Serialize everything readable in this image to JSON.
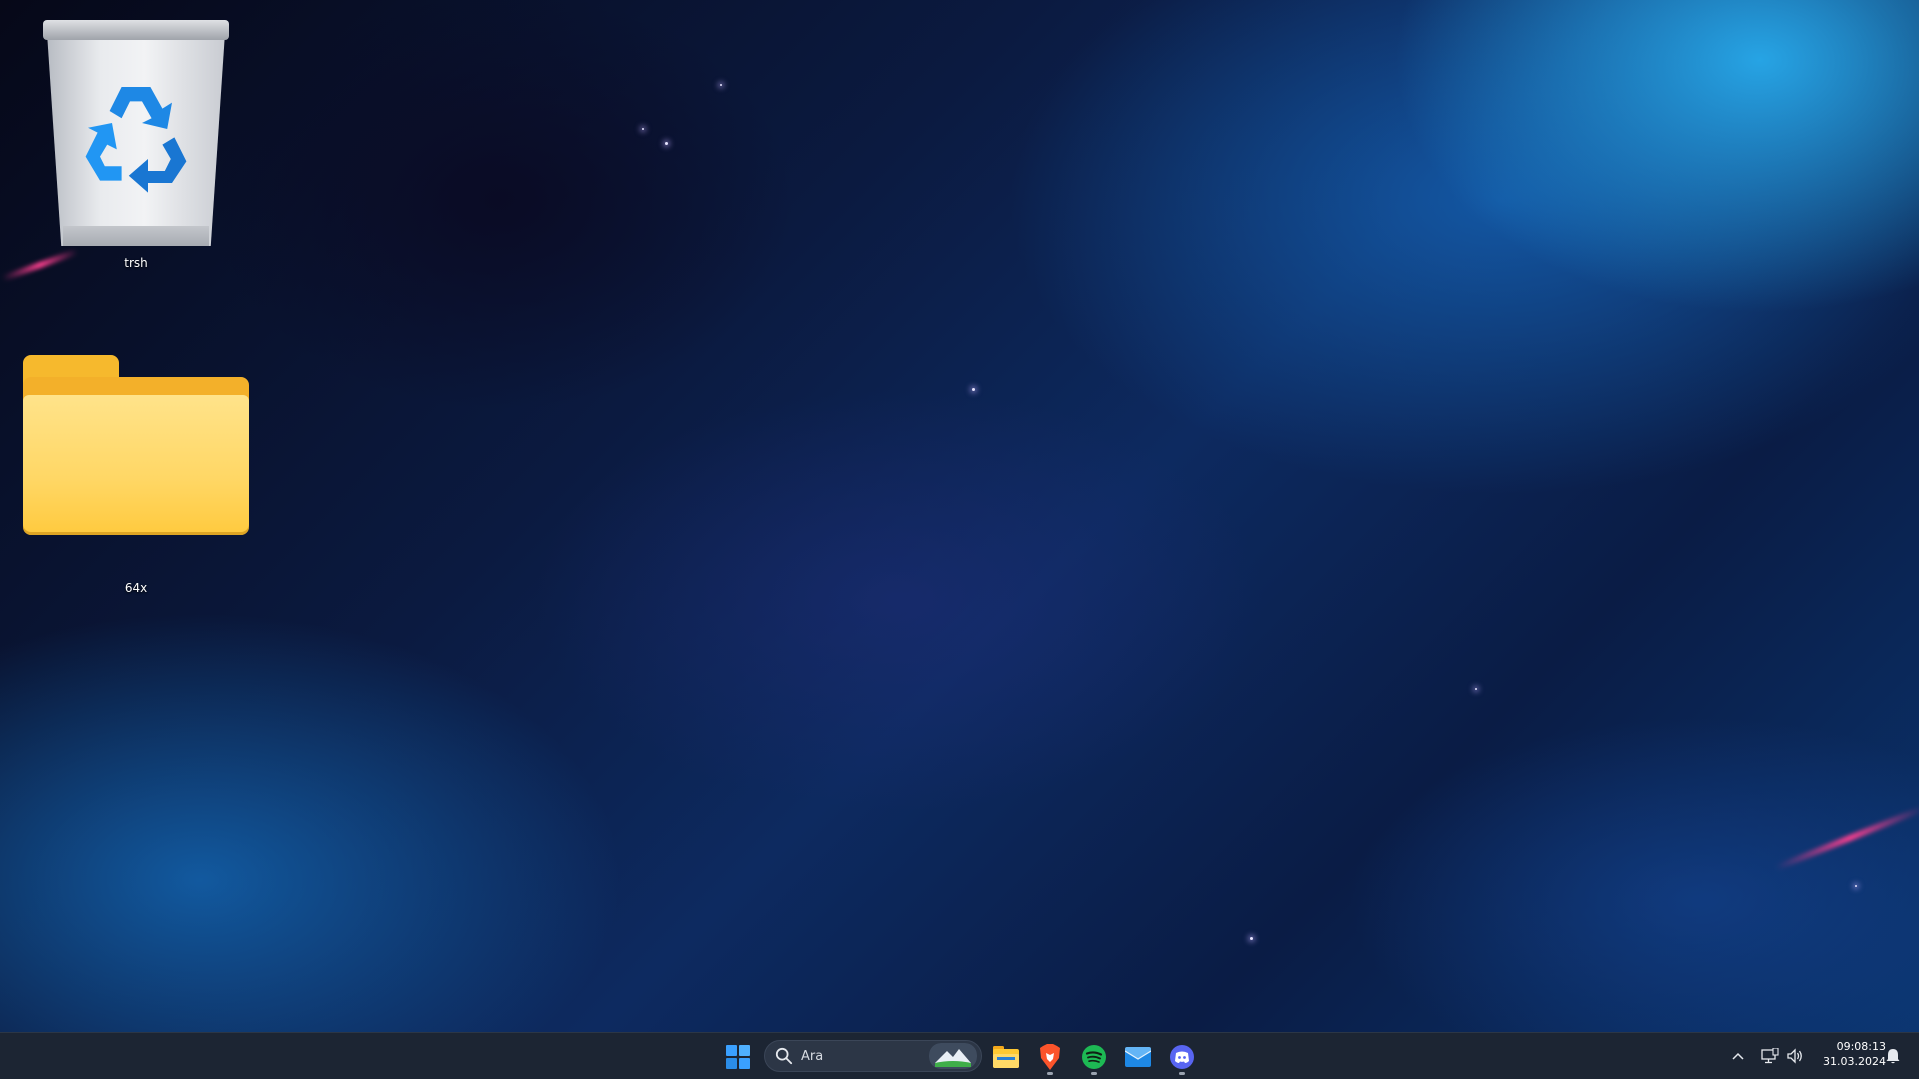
{
  "desktop": {
    "icons": [
      {
        "label": "trsh",
        "icon": "recycle-bin-icon"
      },
      {
        "label": "64x",
        "icon": "folder-icon"
      }
    ]
  },
  "taskbar": {
    "start_icon": "windows-start-icon",
    "search": {
      "placeholder": "Ara"
    },
    "apps": [
      {
        "name": "file-explorer",
        "icon": "folder-icon"
      },
      {
        "name": "brave",
        "icon": "brave-lion-icon"
      },
      {
        "name": "spotify",
        "icon": "spotify-icon"
      },
      {
        "name": "mail",
        "icon": "mail-icon"
      },
      {
        "name": "discord",
        "icon": "discord-icon"
      }
    ],
    "tray": {
      "chevron_icon": "chevron-up-icon",
      "network_icon": "network-icon",
      "volume_icon": "volume-icon",
      "notification_icon": "bell-icon"
    },
    "clock": {
      "time": "09:08:13",
      "date": "31.03.2024"
    }
  },
  "colors": {
    "taskbar_bg": "#1c2533",
    "folder_yellow": "#ffd765",
    "recycle_blue": "#1e88e5",
    "spotify_green": "#1db954",
    "discord_blurple": "#5865f2",
    "brave_orange": "#fb542b",
    "windows_blue": "#3aa0ff"
  }
}
